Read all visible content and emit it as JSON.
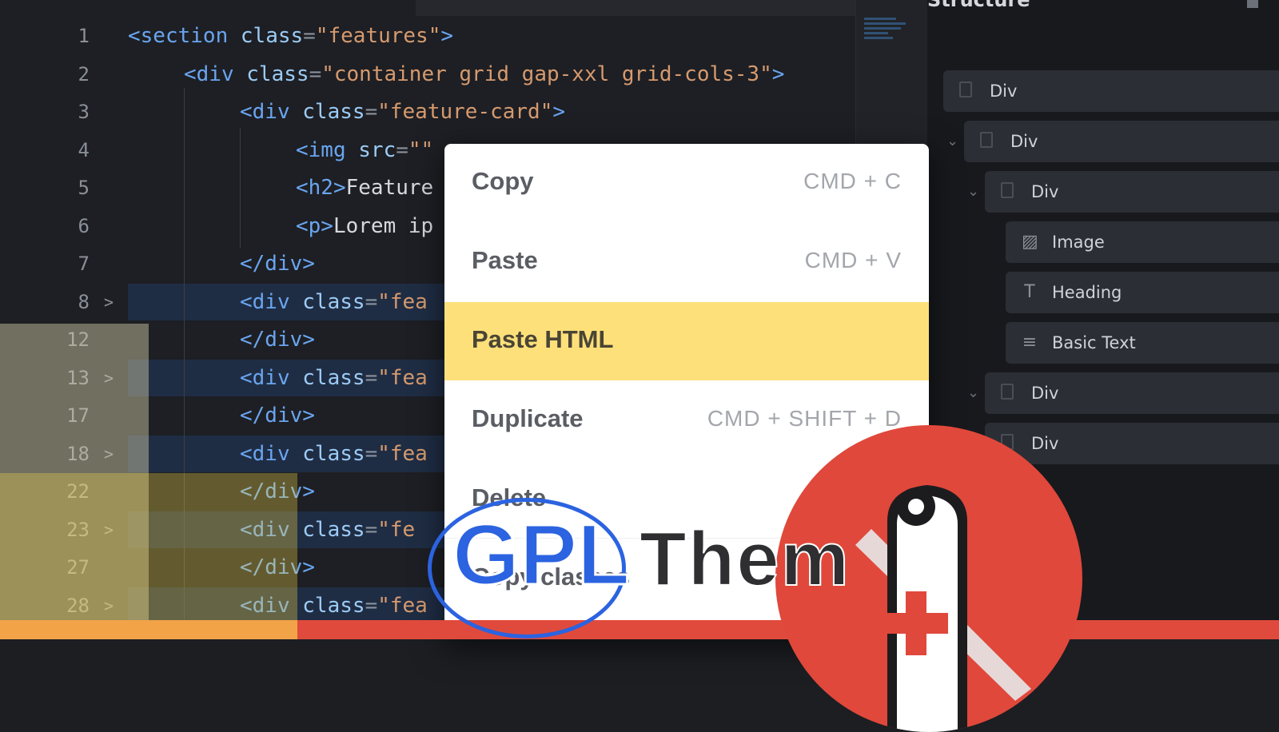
{
  "editor": {
    "lines": [
      {
        "num": "1",
        "fold": "",
        "hl": false,
        "indent": 0,
        "parts": [
          [
            "tag",
            "<section"
          ],
          [
            "txt",
            " "
          ],
          [
            "attr",
            "class"
          ],
          [
            "pun",
            "="
          ],
          [
            "str",
            "\"features\""
          ],
          [
            "tag",
            ">"
          ]
        ]
      },
      {
        "num": "2",
        "fold": "",
        "hl": false,
        "indent": 1,
        "parts": [
          [
            "tag",
            "<div"
          ],
          [
            "txt",
            " "
          ],
          [
            "attr",
            "class"
          ],
          [
            "pun",
            "="
          ],
          [
            "str",
            "\"container grid gap-xxl grid-cols-3\""
          ],
          [
            "tag",
            ">"
          ]
        ]
      },
      {
        "num": "3",
        "fold": "",
        "hl": false,
        "indent": 2,
        "parts": [
          [
            "tag",
            "<div"
          ],
          [
            "txt",
            " "
          ],
          [
            "attr",
            "class"
          ],
          [
            "pun",
            "="
          ],
          [
            "str",
            "\"feature-card\""
          ],
          [
            "tag",
            ">"
          ]
        ]
      },
      {
        "num": "4",
        "fold": "",
        "hl": false,
        "indent": 3,
        "parts": [
          [
            "tag",
            "<img"
          ],
          [
            "txt",
            " "
          ],
          [
            "attr",
            "src"
          ],
          [
            "pun",
            "="
          ],
          [
            "str",
            "\"\""
          ]
        ]
      },
      {
        "num": "5",
        "fold": "",
        "hl": false,
        "indent": 3,
        "parts": [
          [
            "tag",
            "<h2>"
          ],
          [
            "txt",
            "Feature"
          ]
        ]
      },
      {
        "num": "6",
        "fold": "",
        "hl": false,
        "indent": 3,
        "parts": [
          [
            "tag",
            "<p>"
          ],
          [
            "txt",
            "Lorem ip"
          ]
        ]
      },
      {
        "num": "7",
        "fold": "",
        "hl": false,
        "indent": 2,
        "parts": [
          [
            "tag",
            "</div>"
          ]
        ]
      },
      {
        "num": "8",
        "fold": ">",
        "hl": true,
        "indent": 2,
        "parts": [
          [
            "tag",
            "<div"
          ],
          [
            "txt",
            " "
          ],
          [
            "attr",
            "class"
          ],
          [
            "pun",
            "="
          ],
          [
            "str",
            "\"fea"
          ]
        ]
      },
      {
        "num": "12",
        "fold": "",
        "hl": false,
        "indent": 2,
        "parts": [
          [
            "tag",
            "</div>"
          ]
        ]
      },
      {
        "num": "13",
        "fold": ">",
        "hl": true,
        "indent": 2,
        "parts": [
          [
            "tag",
            "<div"
          ],
          [
            "txt",
            " "
          ],
          [
            "attr",
            "class"
          ],
          [
            "pun",
            "="
          ],
          [
            "str",
            "\"fea"
          ]
        ]
      },
      {
        "num": "17",
        "fold": "",
        "hl": false,
        "indent": 2,
        "parts": [
          [
            "tag",
            "</div>"
          ]
        ]
      },
      {
        "num": "18",
        "fold": ">",
        "hl": true,
        "indent": 2,
        "parts": [
          [
            "tag",
            "<div"
          ],
          [
            "txt",
            " "
          ],
          [
            "attr",
            "class"
          ],
          [
            "pun",
            "="
          ],
          [
            "str",
            "\"fea"
          ]
        ]
      },
      {
        "num": "22",
        "fold": "",
        "hl": false,
        "indent": 2,
        "parts": [
          [
            "tag",
            "</div>"
          ]
        ]
      },
      {
        "num": "23",
        "fold": ">",
        "hl": true,
        "indent": 2,
        "parts": [
          [
            "tag",
            "<div"
          ],
          [
            "txt",
            " "
          ],
          [
            "attr",
            "class"
          ],
          [
            "pun",
            "="
          ],
          [
            "str",
            "\"fe"
          ]
        ]
      },
      {
        "num": "27",
        "fold": "",
        "hl": false,
        "indent": 2,
        "parts": [
          [
            "tag",
            "</div>"
          ]
        ]
      },
      {
        "num": "28",
        "fold": ">",
        "hl": true,
        "indent": 2,
        "parts": [
          [
            "tag",
            "<div"
          ],
          [
            "txt",
            " "
          ],
          [
            "attr",
            "class"
          ],
          [
            "pun",
            "="
          ],
          [
            "str",
            "\"fea"
          ]
        ]
      }
    ]
  },
  "panel": {
    "title": "Structure",
    "items": [
      {
        "label": "Div",
        "icon": "box",
        "chevron": false,
        "level": 0
      },
      {
        "label": "Div",
        "icon": "box",
        "chevron": true,
        "level": 1
      },
      {
        "label": "Div",
        "icon": "box",
        "chevron": true,
        "level": 2
      },
      {
        "label": "Image",
        "icon": "image",
        "chevron": false,
        "level": 3
      },
      {
        "label": "Heading",
        "icon": "heading",
        "chevron": false,
        "level": 3
      },
      {
        "label": "Basic Text",
        "icon": "text",
        "chevron": false,
        "level": 3
      },
      {
        "label": "Div",
        "icon": "box",
        "chevron": true,
        "level": 2
      },
      {
        "label": "Div",
        "icon": "box",
        "chevron": false,
        "level": 2
      }
    ]
  },
  "context_menu": {
    "items": [
      {
        "label": "Copy",
        "shortcut": "CMD + C",
        "active": false
      },
      {
        "label": "Paste",
        "shortcut": "CMD + V",
        "active": false
      },
      {
        "label": "Paste HTML",
        "shortcut": "",
        "active": true
      },
      {
        "label": "Duplicate",
        "shortcut": "CMD + SHIFT + D",
        "active": false
      },
      {
        "label": "Delete",
        "shortcut": "",
        "active": false
      },
      {
        "label": "Copy classes",
        "shortcut": "",
        "active": false
      }
    ]
  },
  "watermark": {
    "brand": "GPL",
    "text": "Them"
  },
  "colors": {
    "accent_yellow": "#fde07a",
    "badge_red": "#e0483b",
    "logo_blue": "#2b63e0"
  }
}
